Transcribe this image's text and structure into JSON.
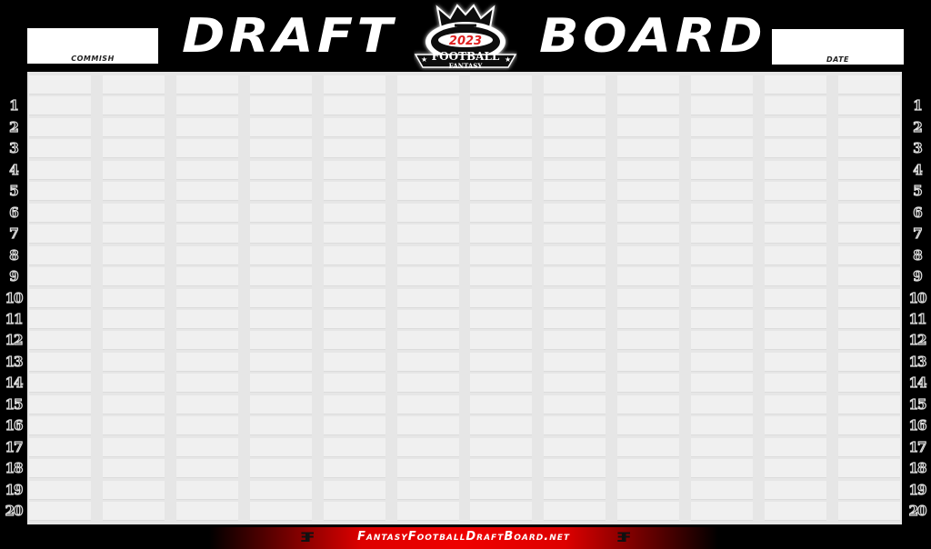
{
  "header": {
    "title_left": "DRAFT",
    "title_right": "BOARD",
    "commish_label": "COMMISH",
    "commish_value": "",
    "date_label": "DATE",
    "date_value": ""
  },
  "logo": {
    "icon": "crown-football-logo",
    "year": "2023",
    "line1": "FOOTBALL",
    "line2": "FANTASY",
    "colors": {
      "year": "#e02020",
      "text": "#ffffff",
      "background": "#000000"
    }
  },
  "board": {
    "columns": 12,
    "team_header_row": [
      "",
      "",
      "",
      "",
      "",
      "",
      "",
      "",
      "",
      "",
      "",
      ""
    ],
    "round_labels": [
      "1",
      "2",
      "3",
      "4",
      "5",
      "6",
      "7",
      "8",
      "9",
      "10",
      "11",
      "12",
      "13",
      "14",
      "15",
      "16",
      "17",
      "18",
      "19",
      "20"
    ],
    "picks": []
  },
  "footer": {
    "icon": "ff-monogram-icon",
    "text": "FantasyFootballDraftBoard.net",
    "accent_color": "#dd0000"
  }
}
